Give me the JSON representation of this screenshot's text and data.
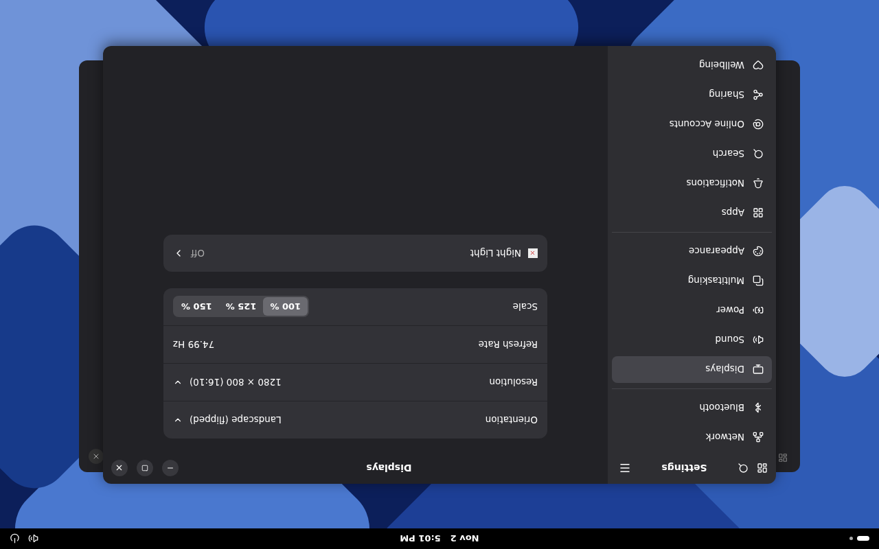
{
  "top_bar": {
    "date": "Nov 2",
    "time": "5:01 PM"
  },
  "window": {
    "sidebar": {
      "title": "Settings",
      "groups": [
        {
          "items": [
            {
              "label": "Network",
              "selected": false
            },
            {
              "label": "Bluetooth",
              "selected": false
            }
          ]
        },
        {
          "items": [
            {
              "label": "Displays",
              "selected": true
            },
            {
              "label": "Sound",
              "selected": false
            },
            {
              "label": "Power",
              "selected": false
            },
            {
              "label": "Multitasking",
              "selected": false
            },
            {
              "label": "Appearance",
              "selected": false
            }
          ]
        },
        {
          "items": [
            {
              "label": "Apps",
              "selected": false
            },
            {
              "label": "Notifications",
              "selected": false
            },
            {
              "label": "Search",
              "selected": false
            },
            {
              "label": "Online Accounts",
              "selected": false
            },
            {
              "label": "Sharing",
              "selected": false
            },
            {
              "label": "Wellbeing",
              "selected": false
            }
          ]
        }
      ]
    },
    "content": {
      "title": "Displays",
      "rows": [
        {
          "kind": "dropdown",
          "label": "Orientation",
          "value": "Landscape (flipped)"
        },
        {
          "kind": "dropdown",
          "label": "Resolution",
          "value": "1280 × 800 (16:10)"
        },
        {
          "kind": "text",
          "label": "Refresh Rate",
          "value": "74.99 Hz"
        },
        {
          "kind": "segmented",
          "label": "Scale",
          "options": [
            {
              "label": "100 %",
              "selected": true
            },
            {
              "label": "125 %",
              "selected": false
            },
            {
              "label": "150 %",
              "selected": false
            }
          ]
        }
      ],
      "night_light": {
        "label": "Night Light",
        "value": "Off"
      }
    }
  }
}
